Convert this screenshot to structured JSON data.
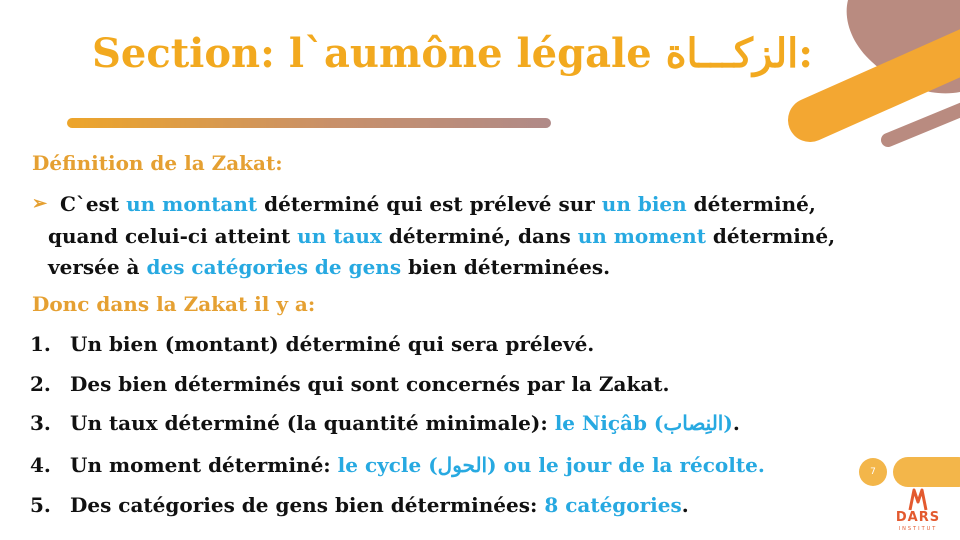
{
  "slide": {
    "title": "Section: l`aumône légale الزكـــاة:",
    "page_number": "7",
    "definition_heading": "Définition de la Zakat:",
    "definition_lines": [
      [
        {
          "text": "C`est ",
          "hl": false
        },
        {
          "text": "un montant",
          "hl": true
        },
        {
          "text": " déterminé qui est prélevé sur ",
          "hl": false
        },
        {
          "text": "un bien",
          "hl": true
        },
        {
          "text": " déterminé,",
          "hl": false
        }
      ],
      [
        {
          "text": "quand celui-ci atteint ",
          "hl": false
        },
        {
          "text": "un taux",
          "hl": true
        },
        {
          "text": " déterminé, dans ",
          "hl": false
        },
        {
          "text": "un moment",
          "hl": true
        },
        {
          "text": " déterminé,",
          "hl": false
        }
      ],
      [
        {
          "text": "versée à ",
          "hl": false
        },
        {
          "text": "des catégories de gens",
          "hl": true
        },
        {
          "text": " bien déterminées.",
          "hl": false
        }
      ]
    ],
    "list_heading": "Donc dans la Zakat il y a:",
    "list_items": [
      {
        "num": "1.",
        "parts": [
          {
            "text": "Un bien (montant) déterminé qui sera prélevé.",
            "hl": false
          }
        ]
      },
      {
        "num": "2.",
        "parts": [
          {
            "text": "Des bien déterminés qui sont concernés par la Zakat.",
            "hl": false
          }
        ]
      },
      {
        "num": "3.",
        "parts": [
          {
            "text": "Un taux déterminé (la quantité minimale): ",
            "hl": false
          },
          {
            "text": "le Niçâb (النِصاب)",
            "hl": true
          },
          {
            "text": ".",
            "hl": false
          }
        ]
      },
      {
        "num": "4.",
        "parts": [
          {
            "text": "Un moment déterminé: ",
            "hl": false
          },
          {
            "text": "le cycle (الحول) ou le jour de la récolte.",
            "hl": true
          }
        ]
      },
      {
        "num": "5.",
        "parts": [
          {
            "text": "Des catégories de gens bien déterminées: ",
            "hl": false
          },
          {
            "text": "8 catégories",
            "hl": true
          },
          {
            "text": ".",
            "hl": false
          }
        ]
      }
    ],
    "logo_text": "DARS",
    "logo_subtext": "INSTITUT"
  },
  "colors": {
    "title": "#f2a91f",
    "heading": "#e5a032",
    "highlight": "#27a9e1",
    "body_text": "#111111",
    "deco_brown": "#b98b80",
    "deco_orange": "#f3a732"
  }
}
